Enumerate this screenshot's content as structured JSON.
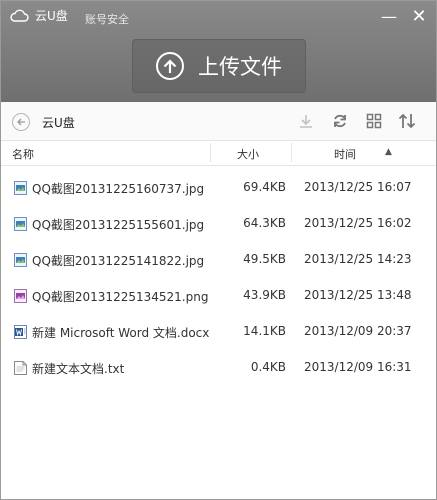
{
  "app": {
    "title": "云U盘",
    "account_tab": "账号安全"
  },
  "window_controls": {
    "minimize": "—",
    "close": "✕"
  },
  "upload": {
    "label": "上传文件"
  },
  "toolbar": {
    "breadcrumb": "云U盘",
    "icons": [
      "download-icon",
      "refresh-icon",
      "grid-view-icon",
      "sort-icon"
    ]
  },
  "columns": {
    "name": "名称",
    "size": "大小",
    "time": "时间",
    "sort_indicator": "▲"
  },
  "files": [
    {
      "name": "QQ截图20131225160737.jpg",
      "size": "69.4KB",
      "time": "2013/12/25 16:07",
      "icon": "image-file-icon"
    },
    {
      "name": "QQ截图20131225155601.jpg",
      "size": "64.3KB",
      "time": "2013/12/25 16:02",
      "icon": "image-file-icon"
    },
    {
      "name": "QQ截图20131225141822.jpg",
      "size": "49.5KB",
      "time": "2013/12/25 14:23",
      "icon": "image-file-icon"
    },
    {
      "name": "QQ截图20131225134521.png",
      "size": "43.9KB",
      "time": "2013/12/25 13:48",
      "icon": "png-file-icon"
    },
    {
      "name": "新建 Microsoft Word 文档.docx",
      "size": "14.1KB",
      "time": "2013/12/09 20:37",
      "icon": "word-file-icon"
    },
    {
      "name": "新建文本文档.txt",
      "size": "0.4KB",
      "time": "2013/12/09 16:31",
      "icon": "text-file-icon"
    }
  ],
  "colors": {
    "titlebar": "#7c7c7c",
    "image_icon": "#3d7fbf",
    "png_icon": "#9b3fa8",
    "word_icon": "#2b5797"
  }
}
